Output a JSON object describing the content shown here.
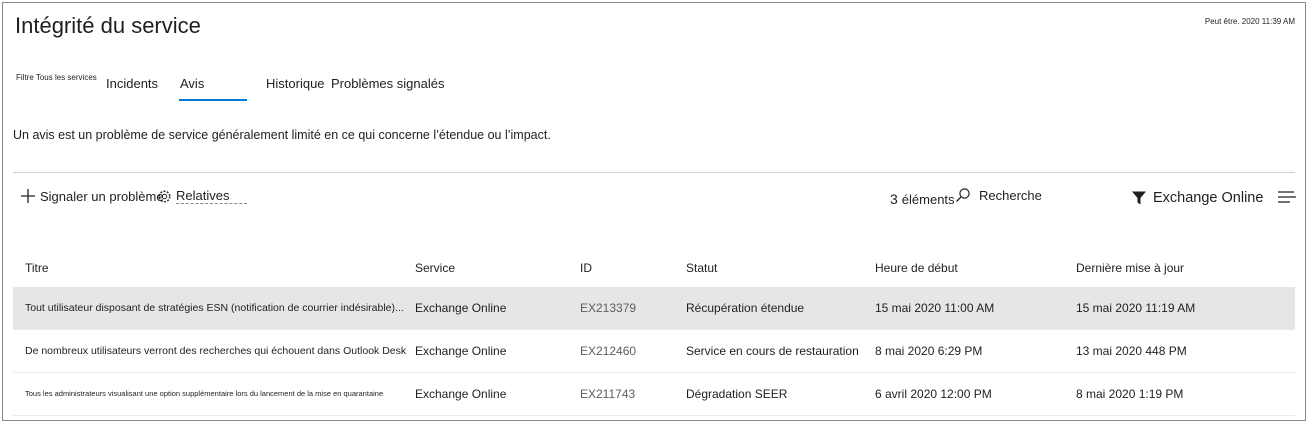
{
  "page": {
    "title": "Intégrité du service",
    "timestamp": "Peut être. 2020 11:39 AM"
  },
  "tabs": {
    "filter_label": "Filtre Tous les services",
    "items": [
      "Incidents",
      "Avis",
      "Historique",
      "Problèmes signalés"
    ],
    "active": "Avis"
  },
  "description": "Un avis est un problème de service généralement limité en ce qui concerne l’étendue ou l’impact.",
  "toolbar": {
    "report_label": "Signaler un problème",
    "relatives_label": "Relatives",
    "count_number": "3",
    "count_label": "éléments",
    "search_placeholder": "Recherche",
    "filter_label": "Exchange Online"
  },
  "icons": {
    "add": "plus-icon",
    "relatives": "gear-icon",
    "search": "search-icon",
    "filter": "filter-icon",
    "menu": "menu-icon"
  },
  "colors": {
    "accent": "#0078d4",
    "selected_row": "#e6e6e6"
  },
  "table": {
    "columns": [
      "Titre",
      "Service",
      "ID",
      "Statut",
      "Heure de début",
      "Dernière mise à jour"
    ],
    "rows": [
      {
        "title": "Tout utilisateur disposant de stratégies ESN (notification de courrier indésirable)...",
        "service": "Exchange Online",
        "id": "EX213379",
        "status": "Récupération étendue",
        "start": "15 mai 2020 11:00 AM",
        "updated": "15 mai 2020 11:19 AM",
        "selected": true
      },
      {
        "title": "De nombreux utilisateurs verront des recherches qui échouent dans Outlook Desk",
        "service": "Exchange Online",
        "id": "EX212460",
        "status": "Service en cours de restauration",
        "start": "8 mai 2020 6:29 PM",
        "updated": "13 mai 2020 448 PM",
        "selected": false
      },
      {
        "title": "Tous les administrateurs visualisant une option supplémentaire lors du lancement de la mise en quarantaine",
        "service": "Exchange Online",
        "id": "EX211743",
        "status": "Dégradation SEER",
        "start": "6 avril 2020 12:00 PM",
        "updated": "8 mai 2020 1:19 PM",
        "selected": false
      }
    ]
  }
}
